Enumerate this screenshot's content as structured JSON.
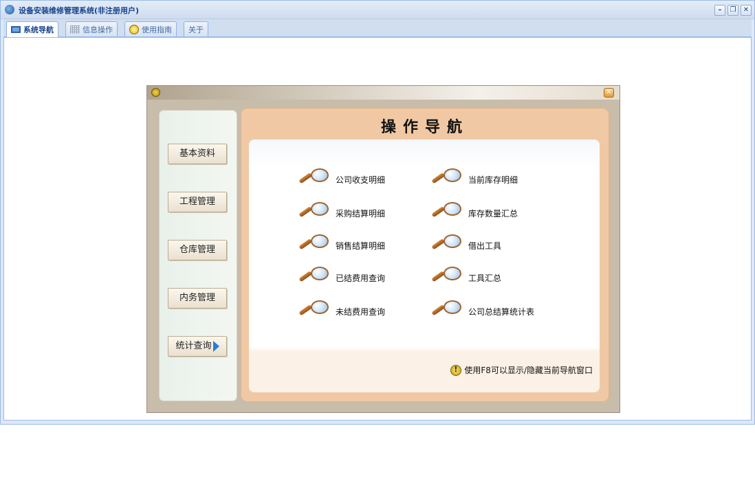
{
  "app": {
    "title": "设备安装维修管理系统(非注册用户)",
    "window_buttons": {
      "minimize": "–",
      "restore": "❐",
      "close": "✕"
    }
  },
  "tabs": [
    {
      "label": "系统导航",
      "icon": "monitor-icon",
      "active": true
    },
    {
      "label": "信息操作",
      "icon": "grid-icon",
      "active": false
    },
    {
      "label": "使用指南",
      "icon": "help-icon",
      "active": false
    },
    {
      "label": "关于",
      "icon": "",
      "active": false
    }
  ],
  "nav": {
    "close_glyph": "✕",
    "heading": "操作导航",
    "side_buttons": [
      "基本资料",
      "工程管理",
      "仓库管理",
      "内务管理",
      "统计查询"
    ],
    "links_left": [
      "公司收支明细",
      "采购结算明细",
      "销售结算明细",
      "已结费用查询",
      "未结费用查询"
    ],
    "links_right": [
      "当前库存明细",
      "库存数量汇总",
      "借出工具",
      "工具汇总",
      "公司总结算统计表"
    ],
    "hint": "使用F8可以显示/隐藏当前导航窗口"
  },
  "colors": {
    "title_text": "#15428b",
    "nav_frame": "#f0c9a4",
    "side_panel": "#e9f0ea"
  }
}
